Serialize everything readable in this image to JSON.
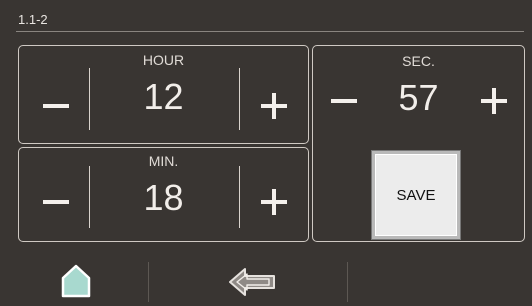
{
  "header": {
    "screen_id": "1.1-2"
  },
  "hour": {
    "label": "HOUR",
    "value": "12"
  },
  "minute": {
    "label": "MIN.",
    "value": "18"
  },
  "second": {
    "label": "SEC.",
    "value": "57"
  },
  "actions": {
    "save_label": "SAVE"
  },
  "nav": {
    "icons": [
      "home-icon",
      "back-arrow-icon"
    ]
  },
  "colors": {
    "background": "#393532",
    "border": "#cfc9c3",
    "save_button": "#ececec",
    "home_icon_fill": "#a8d9cf"
  }
}
